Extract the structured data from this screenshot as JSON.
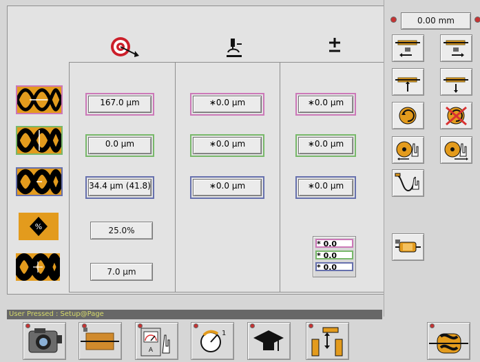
{
  "main": {
    "column_headers": [
      "target-icon",
      "microscope-icon",
      "plus-minus-icon"
    ],
    "rows": [
      {
        "col1": "167.0 µm",
        "col2": "∗0.0 µm",
        "col3": "∗0.0 µm"
      },
      {
        "col1": "0.0 µm",
        "col2": "∗0.0 µm",
        "col3": "∗0.0 µm"
      },
      {
        "col1": "34.4 µm (41.8)",
        "col2": "∗0.0 µm",
        "col3": "∗0.0 µm"
      }
    ],
    "percent_value": "25.0%",
    "bottom_value": "7.0 µm",
    "summary_values": [
      "* 0.0",
      "* 0.0",
      "* 0.0"
    ]
  },
  "right_panel": {
    "zoom_value": "0.00 mm"
  },
  "status": {
    "text": "User Pressed : Setup@Page"
  },
  "colors": {
    "pink": "#cc78b8",
    "green": "#78b86a",
    "blue": "#6670ad",
    "status_bg": "#676767",
    "status_text": "#d5d96a",
    "accent_orange": "#e39b1d"
  }
}
